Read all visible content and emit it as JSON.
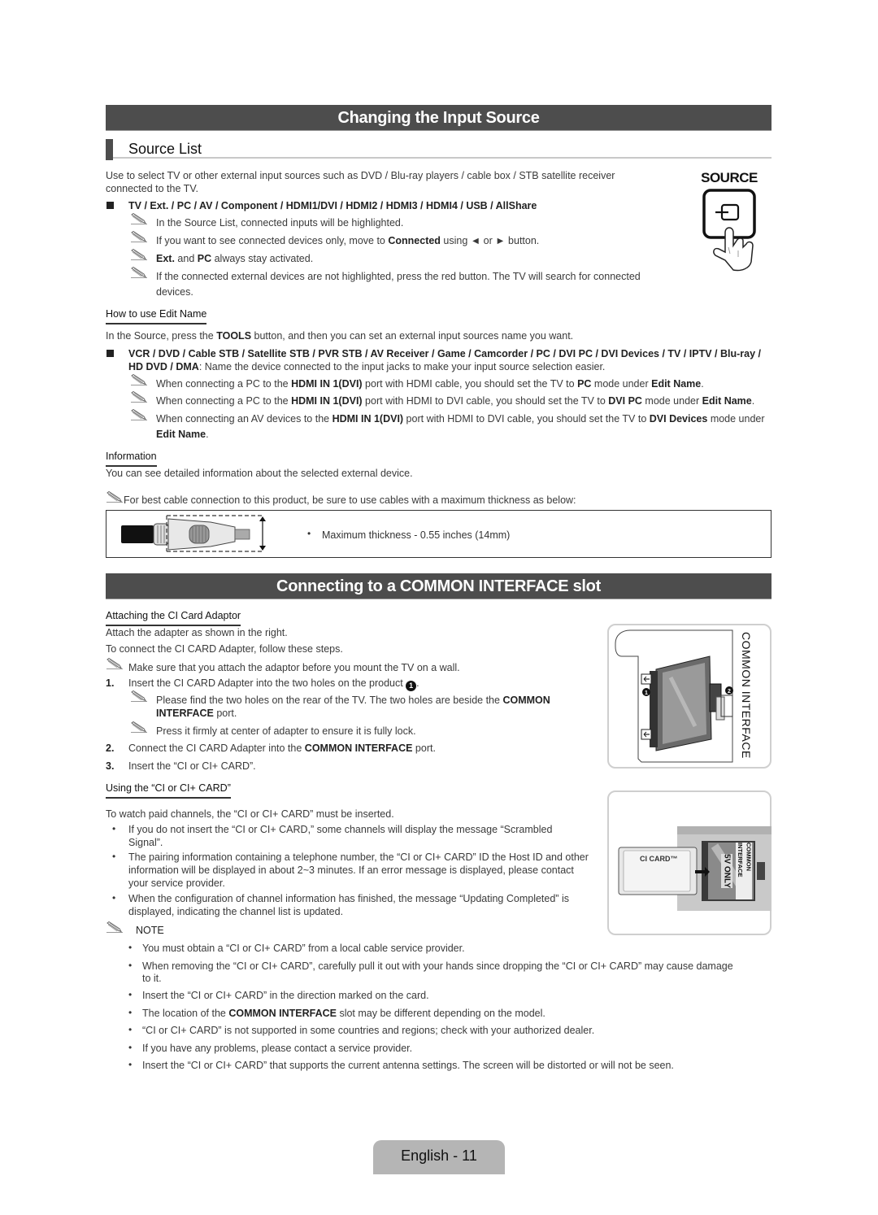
{
  "section1": {
    "title": "Changing the Input Source",
    "subsection": "Source List",
    "intro_line1": "Use to select TV or other external input sources such as DVD / Blu-ray players / cable box / STB satellite receiver",
    "intro_line2": "connected to the TV.",
    "sources_list": "TV / Ext. / PC / AV / Component / HDMI1/DVI / HDMI2 / HDMI3 / HDMI4 / USB / AllShare",
    "notes": [
      {
        "text": "In the Source List, connected inputs will be highlighted."
      },
      {
        "pre": "If you want to see connected devices only, move to ",
        "bold": "Connected",
        "post": " using ◄ or ► button."
      },
      {
        "bold1": "Ext.",
        "mid": " and ",
        "bold2": "PC",
        "post": " always stay activated."
      },
      {
        "line1": "If the connected external devices are not highlighted, press the red button. The TV will search for connected",
        "line2": "devices."
      }
    ],
    "source_button_label": "SOURCE",
    "edit_name": {
      "heading": "How to use Edit Name",
      "intro_pre": "In the Source, press the ",
      "intro_bold": "TOOLS",
      "intro_post": " button, and then you can set an external input sources name you want.",
      "devices_line1": "VCR / DVD / Cable STB / Satellite STB / PVR STB / AV Receiver / Game / Camcorder / PC / DVI PC / DVI Devices / TV / IPTV / Blu-ray /",
      "devices_line2_bold": "HD DVD / DMA",
      "devices_line2_rest": ": Name the device connected to the input jacks to make your input source selection easier.",
      "notes": [
        {
          "a": "When connecting a PC to the ",
          "b": "HDMI IN 1(DVI)",
          "c": " port with HDMI cable, you should set the TV to ",
          "d": "PC",
          "e": " mode under ",
          "f": "Edit Name",
          "g": "."
        },
        {
          "a": "When connecting a PC to the ",
          "b": "HDMI IN 1(DVI)",
          "c": " port with HDMI to DVI cable, you should set the TV to ",
          "d": "DVI PC",
          "e": " mode under ",
          "f": "Edit Name",
          "g": "."
        },
        {
          "a": "When connecting an AV devices to the ",
          "b": "HDMI IN 1(DVI)",
          "c": " port with HDMI to DVI cable, you should set the TV to ",
          "d": "DVI Devices",
          "e": " mode under",
          "f": "Edit Name",
          "g": "."
        }
      ]
    },
    "information": {
      "heading": "Information",
      "text": "You can see detailed information about the selected external device."
    },
    "cable_note": "For best cable connection to this product, be sure to use cables with a maximum thickness as below:",
    "cable_spec": "Maximum thickness - 0.55 inches (14mm)"
  },
  "section2": {
    "title": "Connecting to a COMMON INTERFACE slot",
    "attaching": {
      "heading": "Attaching the CI Card Adaptor",
      "line1": "Attach the adapter as shown in the right.",
      "line2": "To connect the CI CARD Adapter, follow these steps.",
      "note_wall": "Make sure that you attach the adaptor before you mount the TV on a wall.",
      "steps": [
        {
          "num": "1.",
          "text": "Insert the CI CARD Adapter into the two holes on the product ",
          "marker": "1"
        },
        {
          "num": "2.",
          "pre": "Connect the CI CARD Adapter into the ",
          "bold": "COMMON INTERFACE",
          "post": " port."
        },
        {
          "num": "3.",
          "text": "Insert the “CI or CI+ CARD”."
        }
      ],
      "step1_notes": [
        {
          "pre": "Please find the two holes on the rear of the TV. The two holes are beside the ",
          "bold1": "COMMON",
          "bold2": "INTERFACE",
          "post": " port."
        },
        {
          "text": "Press it firmly at center of adapter to ensure it is fully lock."
        }
      ],
      "figure_label": "COMMON INTERFACE",
      "figure_markers": [
        "1",
        "2"
      ]
    },
    "using": {
      "heading": "Using the “CI or CI+ CARD”",
      "intro": "To watch paid channels, the “CI or CI+ CARD” must be inserted.",
      "bullets": [
        {
          "l1": "If you do not insert the “CI or CI+ CARD,” some channels will display the message “Scrambled",
          "l2": "Signal”."
        },
        {
          "l1": "The pairing information containing a telephone number, the “CI or CI+ CARD” ID the Host ID and other",
          "l2": "information will be displayed in about 2~3 minutes. If an error message is displayed, please contact",
          "l3": "your service provider."
        },
        {
          "l1": "When the configuration of channel information has finished, the message “Updating Completed” is",
          "l2": "displayed, indicating the channel list is updated."
        }
      ],
      "card_label": "CI CARD™",
      "slot_label1": "COMMON INTERFACE",
      "slot_label2": "5V ONLY"
    },
    "note": {
      "heading": "NOTE",
      "items": [
        {
          "text": "You must obtain a “CI or CI+ CARD” from a local cable service provider."
        },
        {
          "l1": "When removing the “CI or CI+ CARD”, carefully pull it out with your hands since dropping the “CI or CI+ CARD” may cause damage",
          "l2": "to it."
        },
        {
          "text": "Insert the “CI or CI+ CARD” in the direction marked on the card."
        },
        {
          "pre": "The location of the ",
          "bold": "COMMON INTERFACE",
          "post": " slot may be different depending on the model."
        },
        {
          "text": "“CI or CI+ CARD” is not supported in some countries and regions; check with your authorized dealer."
        },
        {
          "text": "If you have any problems, please contact a service provider."
        },
        {
          "text": "Insert the “CI or CI+ CARD” that supports the current antenna settings. The screen will be distorted or will not be seen."
        }
      ]
    }
  },
  "footer": {
    "page_label": "English - 11"
  },
  "icons": {
    "note": "pencil-note-icon",
    "bullet_square": "square-bullet-icon",
    "bullet_dot": "dot-bullet-icon"
  }
}
